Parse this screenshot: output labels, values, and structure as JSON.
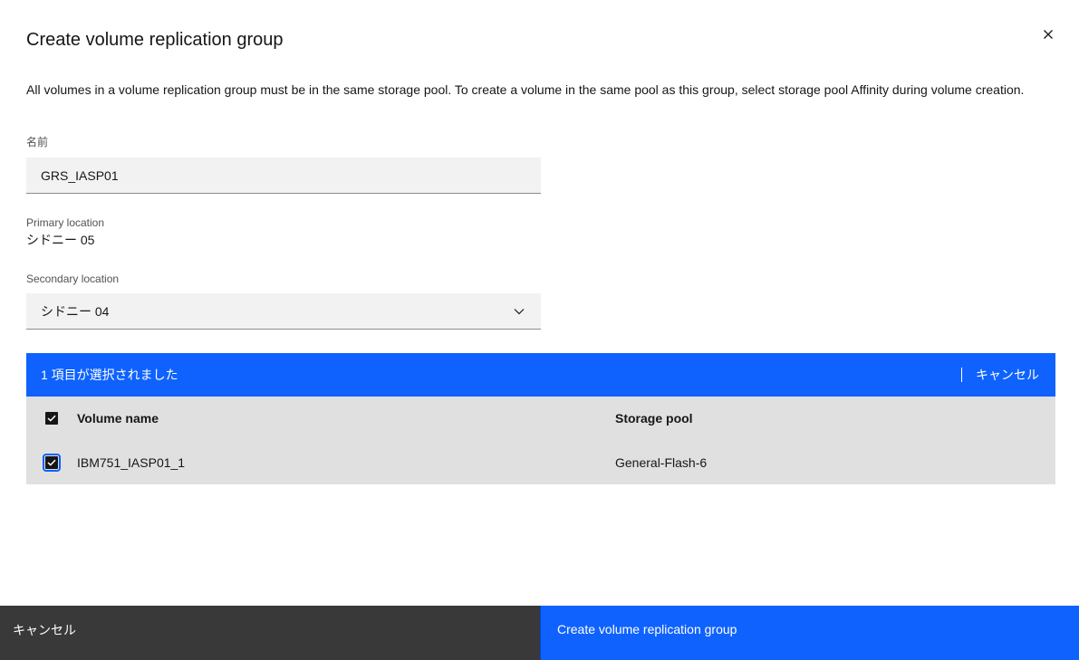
{
  "modal": {
    "title": "Create volume replication group",
    "description": "All volumes in a volume replication group must be in the same storage pool. To create a volume in the same pool as this group, select storage pool Affinity during volume creation."
  },
  "form": {
    "name_label": "名前",
    "name_value": "GRS_IASP01",
    "primary_location_label": "Primary location",
    "primary_location_value": "シドニー 05",
    "secondary_location_label": "Secondary location",
    "secondary_location_value": "シドニー 04"
  },
  "batch_actions": {
    "summary": "1 項目が選択されました",
    "cancel_label": "キャンセル"
  },
  "table": {
    "headers": [
      "Volume name",
      "Storage pool"
    ],
    "rows": [
      {
        "volume_name": "IBM751_IASP01_1",
        "storage_pool": "General-Flash-6",
        "selected": true
      }
    ]
  },
  "footer": {
    "secondary_label": "キャンセル",
    "primary_label": "Create volume replication group"
  },
  "colors": {
    "primary": "#0f62fe",
    "secondary": "#393939",
    "field_bg": "#f2f2f2",
    "table_bg": "#e0e0e0"
  }
}
